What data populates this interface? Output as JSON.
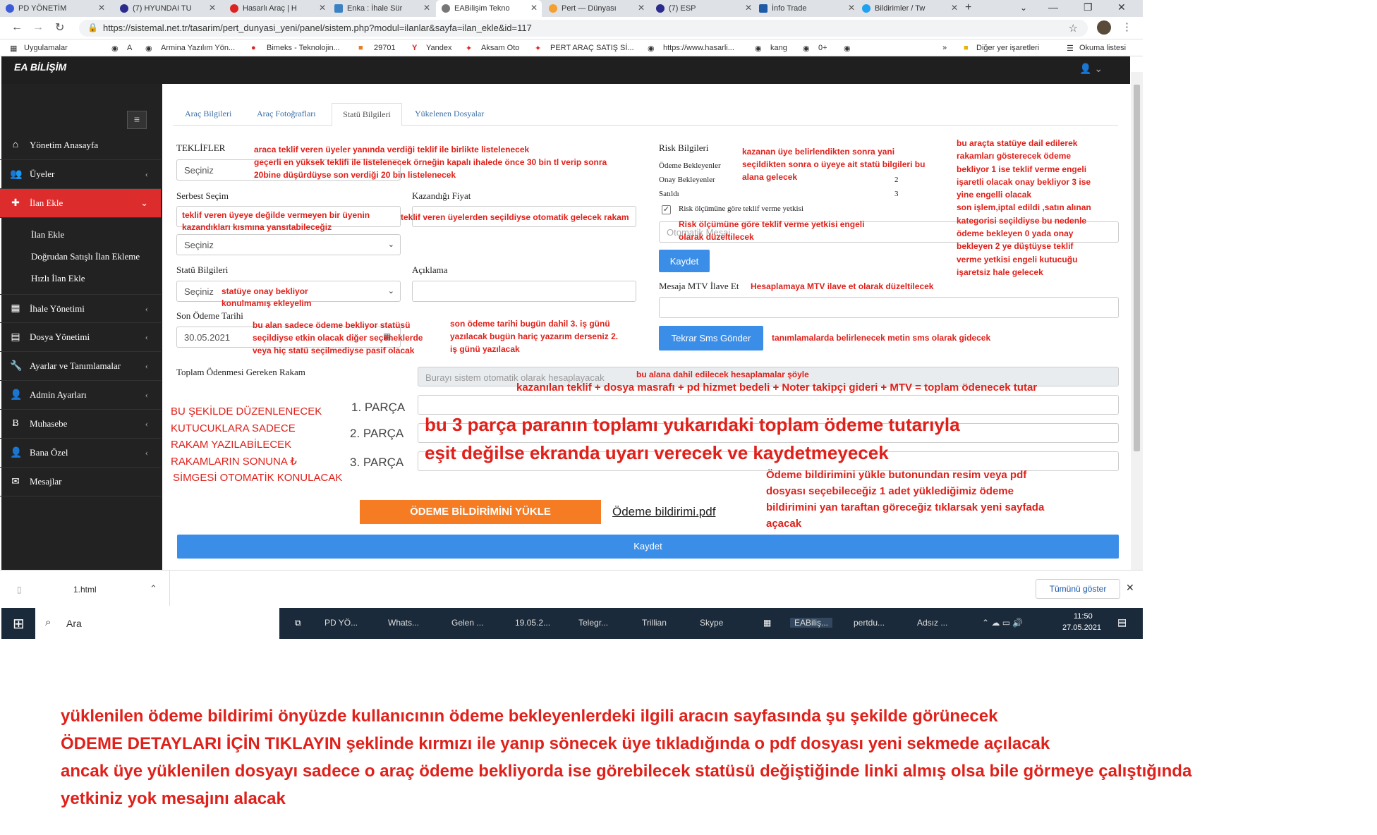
{
  "browser": {
    "tabs": [
      "PD YÖNETİM",
      "(7) HYUNDAI TU",
      "Hasarlı Araç | H",
      "Enka : İhale Sür",
      "EABilişim Tekno",
      "Pert — Dünyası",
      "(7) ESP",
      "İnfo Trade",
      "Bildirimler / Tw"
    ],
    "url": "https://sistemal.net.tr/tasarim/pert_dunyasi_yeni/panel/sistem.php?modul=ilanlar&sayfa=ilan_ekle&id=117",
    "bookmarks": [
      "Uygulamalar",
      "A",
      "Armina Yazılım Yön...",
      "Bimeks - Teknolojin...",
      "29701",
      "Yandex",
      "Aksam Oto",
      "PERT ARAÇ SATIŞ Sİ...",
      "https://www.hasarli...",
      "kang",
      "0+"
    ],
    "other_bookmarks": "Diğer yer işaretleri",
    "reading_list": "Okuma listesi"
  },
  "app": {
    "logo": "EA BİLİŞİM"
  },
  "sidebar": {
    "items": [
      {
        "label": "Yönetim Anasayfa",
        "icon": "home-icon"
      },
      {
        "label": "Üyeler",
        "icon": "users-icon"
      },
      {
        "label": "İlan Ekle",
        "icon": "plus-icon"
      },
      {
        "label": "İhale Yönetimi",
        "icon": "table-icon"
      },
      {
        "label": "Dosya Yönetimi",
        "icon": "file-icon"
      },
      {
        "label": "Ayarlar ve Tanımlamalar",
        "icon": "wrench-icon"
      },
      {
        "label": "Admin Ayarları",
        "icon": "user-cog-icon"
      },
      {
        "label": "Muhasebe",
        "icon": "bitcoin-icon"
      },
      {
        "label": "Bana Özel",
        "icon": "user-icon"
      },
      {
        "label": "Mesajlar",
        "icon": "inbox-icon"
      }
    ],
    "sub": [
      "İlan Ekle",
      "Doğrudan Satışlı İlan Ekleme",
      "Hızlı İlan Ekle"
    ]
  },
  "tabs": [
    "Araç Bilgileri",
    "Araç Fotoğrafları",
    "Statü Bilgileri",
    "Yükelenen Dosyalar"
  ],
  "form": {
    "teklifler": "TEKLİFLER",
    "select_placeholder": "Seçiniz",
    "serbest": "Serbest Seçim",
    "kazandigi": "Kazandığı Fiyat",
    "statu": "Statü Bilgileri",
    "aciklama": "Açıklama",
    "son_odeme": "Son Ödeme Tarihi",
    "date": "30.05.2021",
    "toplam": "Toplam Ödenmesi Gereken Rakam",
    "toplam_ph": "Burayı sistem otomatik olarak hesaplayacak",
    "parca1": "1. PARÇA",
    "parca2": "2. PARÇA",
    "parca3": "3. PARÇA",
    "upload_btn": "ÖDEME BİLDİRİMİNİ YÜKLE",
    "upload_link": "Ödeme bildirimi.pdf",
    "save": "Kaydet"
  },
  "risk": {
    "title": "Risk Bilgileri",
    "rows": [
      {
        "k": "Ödeme Bekleyenler",
        "v": ""
      },
      {
        "k": "Onay Bekleyenler",
        "v": "2"
      },
      {
        "k": "Satıldı",
        "v": "3"
      }
    ],
    "checkbox": "Risk ölçümüne göre teklif verme yetkisi",
    "auto": "Otomatik Mesaj",
    "save": "Kaydet",
    "mtv": "Mesaja MTV İlave Et",
    "sms": "Tekrar Sms Gönder"
  },
  "notes": {
    "n1": [
      "araca teklif veren üyeler yanında verdiği teklif ile birlikte listelenecek",
      "geçerli en yüksek teklifi ile listelenecek örneğin kapalı ihalede önce 30 bin tl verip sonra",
      "20bine düşürdüyse son verdiği 20 bin listelenecek"
    ],
    "n2": [
      "teklif veren üyeye değilde vermeyen bir üyenin",
      "kazandıkları kısmına yansıtabileceğiz"
    ],
    "n3": "teklif veren üyelerden seçildiyse otomatik gelecek rakam",
    "n4": [
      "statüye onay bekliyor",
      "konulmamış ekleyelim"
    ],
    "n5": [
      "bu alan sadece ödeme bekliyor statüsü",
      "seçildiyse etkin olacak diğer seçeneklerde",
      "veya hiç statü seçilmediyse pasif olacak"
    ],
    "n6": [
      "son ödeme tarihi bugün dahil 3. iş günü",
      "yazılacak bugün hariç yazarım derseniz 2.",
      "iş günü yazılacak"
    ],
    "n7": [
      "kazanan üye belirlendikten sonra yani",
      "seçildikten sonra o üyeye ait statü bilgileri bu",
      "alana gelecek"
    ],
    "n8": [
      "bu araçta statüye dail edilerek",
      "rakamları gösterecek ödeme",
      "bekliyor 1 ise teklif verme engeli",
      "işaretli olacak onay bekliyor 3 ise",
      "yine engelli olacak",
      "son işlem,iptal edildi ,satın alınan",
      "kategorisi seçildiyse bu nedenle",
      "ödeme bekleyen 0 yada onay",
      "bekleyen 2 ye düştüyse teklif",
      "verme yetkisi engeli kutucuğu",
      "işaretsiz hale gelecek"
    ],
    "n9": [
      "Risk ölçümüne göre teklif verme yetkisi engeli",
      "olarak düzeltilecek"
    ],
    "n10": "Hesaplamaya MTV ilave et olarak düzeltilecek",
    "n11": "tanımlamalarda belirlenecek  metin sms olarak gidecek",
    "n12": "bu alana dahil edilecek hesaplamalar şöyle",
    "n13": "kazanılan teklif + dosya masrafı + pd hizmet bedeli + Noter takipçi gideri +  MTV = toplam ödenecek tutar",
    "n14": [
      "BU ŞEKİLDE DÜZENLENECEK",
      "KUTUCUKLARA SADECE",
      "RAKAM YAZILABİLECEK",
      "RAKAMLARIN SONUNA ₺",
      "SİMGESİ OTOMATİK KONULACAK"
    ],
    "n15": [
      "bu 3 parça paranın toplamı yukarıdaki toplam ödeme tutarıyla",
      "eşit değilse ekranda uyarı verecek ve kaydetmeyecek"
    ],
    "n16": [
      "Ödeme bildirimini yükle butonundan resim veya pdf",
      "dosyası seçebileceğiz 1 adet yüklediğimiz ödeme",
      "bildirimini yan taraftan göreceğiz tıklarsak yeni sayfada",
      "açacak"
    ],
    "bottom": [
      "yüklenilen ödeme bildirimi önyüzde kullanıcının ödeme bekleyenlerdeki ilgili aracın sayfasında şu şekilde görünecek",
      "ÖDEME DETAYLARI  İÇİN TIKLAYIN şeklinde kırmızı ile yanıp sönecek üye tıkladığında o pdf dosyası yeni sekmede açılacak",
      "ancak üye yüklenilen dosyayı sadece o araç ödeme bekliyorda ise görebilecek statüsü değiştiğinde linki almış olsa bile görmeye çalıştığında",
      "yetkiniz yok mesajını alacak"
    ]
  },
  "download": {
    "file": "1.html",
    "show_all": "Tümünü göster"
  },
  "taskbar": {
    "search": "Ara",
    "items": [
      "PD YÖ...",
      "Whats...",
      "Gelen ...",
      "19.05.2...",
      "Telegr...",
      "Trillian",
      "Skype",
      "EABiliş...",
      "pertdu...",
      "Adsız ..."
    ],
    "time": "11:50",
    "date": "27.05.2021"
  }
}
